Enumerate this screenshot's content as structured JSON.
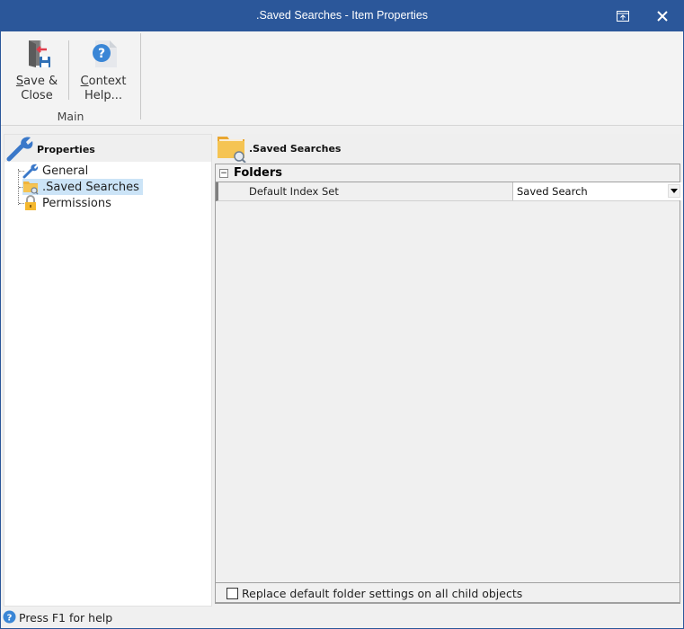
{
  "window": {
    "title": ".Saved Searches - Item Properties",
    "restore_icon": "restore-window-icon",
    "close_icon": "close-icon"
  },
  "ribbon": {
    "buttons": [
      {
        "label_line1": "Save &",
        "label_line2": "Close",
        "accel": "S",
        "icon": "save-close-icon"
      },
      {
        "label_line1": "Context",
        "label_line2": "Help...",
        "accel": "C",
        "icon": "context-help-icon"
      }
    ],
    "group_label": "Main"
  },
  "left_panel": {
    "header": "Properties",
    "items": [
      {
        "label": "General",
        "icon": "wrench-icon",
        "selected": false
      },
      {
        "label": ".Saved Searches",
        "icon": "folder-search-icon",
        "selected": true
      },
      {
        "label": "Permissions",
        "icon": "lock-icon",
        "selected": false
      }
    ]
  },
  "right_panel": {
    "header": ".Saved Searches",
    "category": {
      "toggle": "−",
      "label": "Folders"
    },
    "properties": [
      {
        "name": "Default Index Set",
        "value": "Saved Search"
      }
    ],
    "footer_checkbox": {
      "label": "Replace default folder settings on all child objects",
      "checked": false
    }
  },
  "statusbar": {
    "text": "Press F1 for help"
  }
}
